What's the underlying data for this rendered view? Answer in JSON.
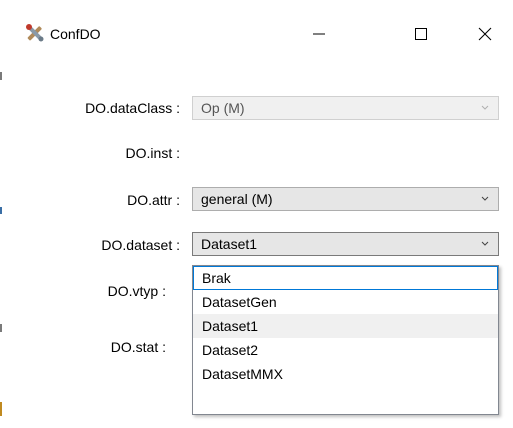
{
  "window": {
    "title": "ConfDO",
    "minimize_symbol": "—",
    "close_symbol": "✕"
  },
  "fields": {
    "dataClass": {
      "label": "DO.dataClass :",
      "value": "Op (M)",
      "enabled": false
    },
    "inst": {
      "label": "DO.inst :"
    },
    "attr": {
      "label": "DO.attr :",
      "value": "general (M)"
    },
    "dataset": {
      "label": "DO.dataset :",
      "value": "Dataset1",
      "expanded": true
    },
    "vtyp": {
      "label": "DO.vtyp :"
    },
    "stat": {
      "label": "DO.stat :"
    }
  },
  "dropdown": {
    "options": [
      "Brak",
      "DatasetGen",
      "Dataset1",
      "Dataset2",
      "DatasetMMX"
    ],
    "highlighted": "Brak",
    "selected": "Dataset1"
  },
  "icons": {
    "app": "tools-icon",
    "chevron": "chevron-down-icon"
  }
}
